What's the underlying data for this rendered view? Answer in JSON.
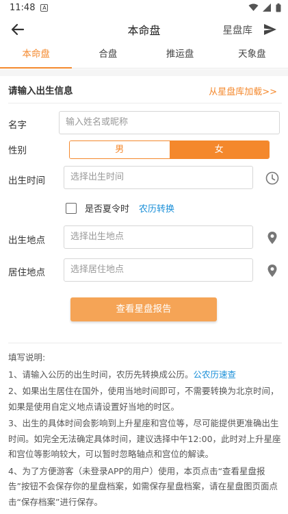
{
  "status_bar": {
    "time": "11:48",
    "notif_glyph": "A"
  },
  "app_bar": {
    "title": "本命盘",
    "right_label": "星盘库"
  },
  "tabs": [
    {
      "label": "本命盘",
      "active": true
    },
    {
      "label": "合盘",
      "active": false
    },
    {
      "label": "推运盘",
      "active": false
    },
    {
      "label": "天象盘",
      "active": false
    }
  ],
  "form": {
    "section_title": "请输入出生信息",
    "load_link": "从星盘库加载>>",
    "name_label": "名字",
    "name_placeholder": "输入姓名或昵称",
    "gender_label": "性别",
    "gender_male": "男",
    "gender_female": "女",
    "gender_selected": "女",
    "birth_time_label": "出生时间",
    "birth_time_placeholder": "选择出生时间",
    "dst_label": "是否夏令时",
    "dst_checked": false,
    "lunar_convert": "农历转换",
    "birth_place_label": "出生地点",
    "birth_place_placeholder": "选择出生地点",
    "living_place_label": "居住地点",
    "living_place_placeholder": "选择居住地点",
    "submit": "查看星盘报告"
  },
  "notes": {
    "title": "填写说明:",
    "n1": "1、请输入公历的出生时间，农历先转换成公历。",
    "n1_link": "公农历速查",
    "n2": "2、如果出生居住在国外，使用当地时间即可，不需要转换为北京时间，如果是使用自定义地点请设置好当地的时区。",
    "n3": "3、出生的具体时间会影响到上升星座和宫位等，尽可能提供更准确出生时间。如完全无法确定具体时间，建议选择中午12:00，此时对上升星座和宫位等影响较大，可以暂时忽略轴点和宫位的解读。",
    "n4": "4、为了方便游客（未登录APP的用户）使用，本页点击“查看星盘报告”按钮不会保存你的星盘档案，如需保存星盘档案，请在星盘图页面点击“保存档案”进行保存。"
  },
  "colors": {
    "accent": "#f4882c",
    "button": "#f5a456",
    "link": "#1a8fd8"
  }
}
